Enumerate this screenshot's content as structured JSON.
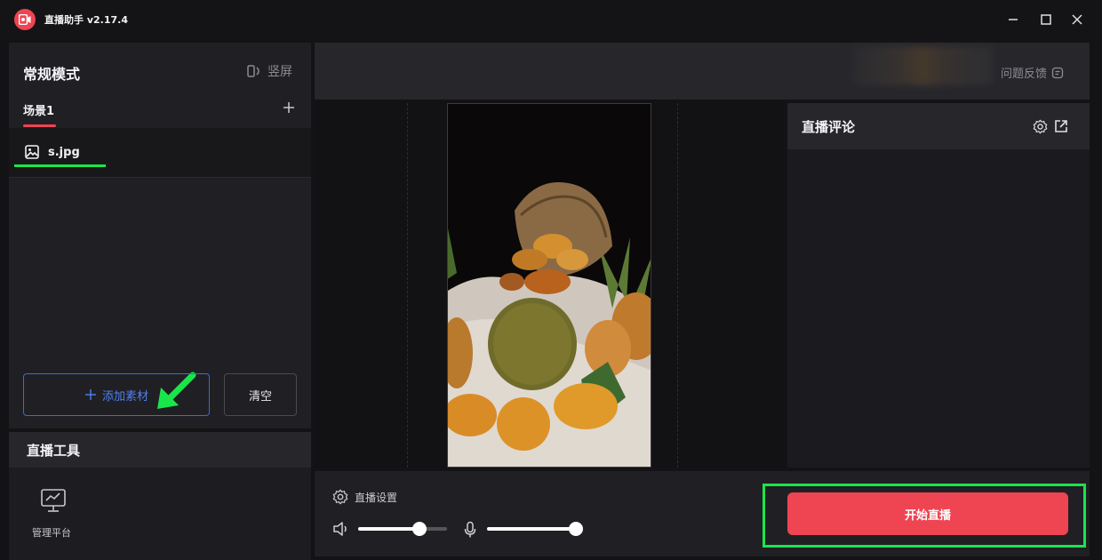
{
  "app": {
    "title": "直播助手 v2.17.4"
  },
  "left": {
    "mode_title": "常规模式",
    "vertical_label": "竖屏",
    "scene_tab": "场景1",
    "assets": [
      {
        "name": "s.jpg"
      }
    ],
    "add_asset_label": "添加素材",
    "clear_label": "清空"
  },
  "tools": {
    "title": "直播工具",
    "items": [
      {
        "label": "管理平台",
        "icon": "monitor-chart-icon"
      }
    ]
  },
  "topbar": {
    "feedback_label": "问题反馈"
  },
  "comments": {
    "title": "直播评论"
  },
  "controls": {
    "settings_label": "直播设置",
    "speaker_volume": 0.69,
    "mic_volume": 1.0
  },
  "start_label": "开始直播",
  "colors": {
    "accent_red": "#ef4452",
    "accent_blue": "#4f7ff0",
    "annotation_green": "#19e64a"
  }
}
